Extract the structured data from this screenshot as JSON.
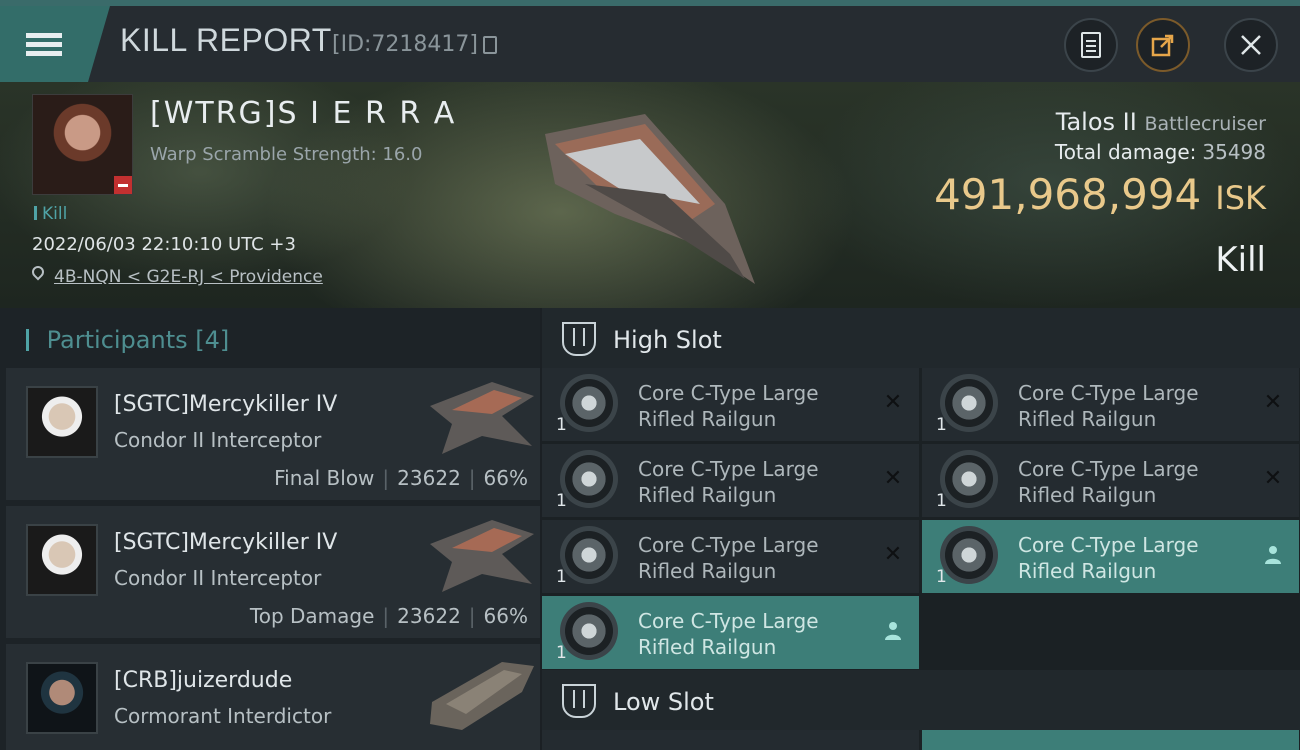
{
  "header": {
    "title": "KILL REPORT",
    "report_id": "[ID:7218417]"
  },
  "victim": {
    "name": "[WTRG]S I E R R A",
    "scramble": "Warp Scramble Strength: 16.0",
    "kill_tag": "Kill",
    "datetime": "2022/06/03 22:10:10 UTC +3",
    "location": "4B-NQN < G2E-RJ < Providence",
    "ship_name": "Talos II",
    "ship_class": "Battlecruiser",
    "total_damage_label": "Total damage:",
    "total_damage": "35498",
    "isk_value": "491,968,994",
    "isk_unit": "ISK",
    "result": "Kill"
  },
  "participants": {
    "heading": "Participants",
    "count": "[4]",
    "items": [
      {
        "name": "[SGTC]Mercykiller IV",
        "ship": "Condor II Interceptor",
        "role": "Final Blow",
        "damage": "23622",
        "percent": "66%"
      },
      {
        "name": "[SGTC]Mercykiller IV",
        "ship": "Condor II Interceptor",
        "role": "Top Damage",
        "damage": "23622",
        "percent": "66%"
      },
      {
        "name": "[CRB]juizerdude",
        "ship": "Cormorant Interdictor"
      }
    ]
  },
  "slots": {
    "high_label": "High Slot",
    "low_label": "Low Slot",
    "high_items": [
      {
        "qty": "1",
        "name": "Core C-Type Large Rifled Railgun",
        "status": "destroyed"
      },
      {
        "qty": "1",
        "name": "Core C-Type Large Rifled Railgun",
        "status": "destroyed"
      },
      {
        "qty": "1",
        "name": "Core C-Type Large Rifled Railgun",
        "status": "destroyed"
      },
      {
        "qty": "1",
        "name": "Core C-Type Large Rifled Railgun",
        "status": "destroyed"
      },
      {
        "qty": "1",
        "name": "Core C-Type Large Rifled Railgun",
        "status": "destroyed"
      },
      {
        "qty": "1",
        "name": "Core C-Type Large Rifled Railgun",
        "status": "dropped"
      },
      {
        "qty": "1",
        "name": "Core C-Type Large Rifled Railgun",
        "status": "dropped"
      }
    ]
  },
  "colors": {
    "accent": "#3d7e78",
    "isk": "#e9c98b",
    "kill_tag": "#4fa3a6",
    "share": "#e6a64a"
  },
  "icons": [
    "menu-icon",
    "copy-icon",
    "document-icon",
    "share-icon",
    "close-icon",
    "location-pin-icon",
    "high-slot-icon",
    "low-slot-icon",
    "railgun-icon",
    "destroyed-x-icon",
    "dropped-person-icon"
  ]
}
